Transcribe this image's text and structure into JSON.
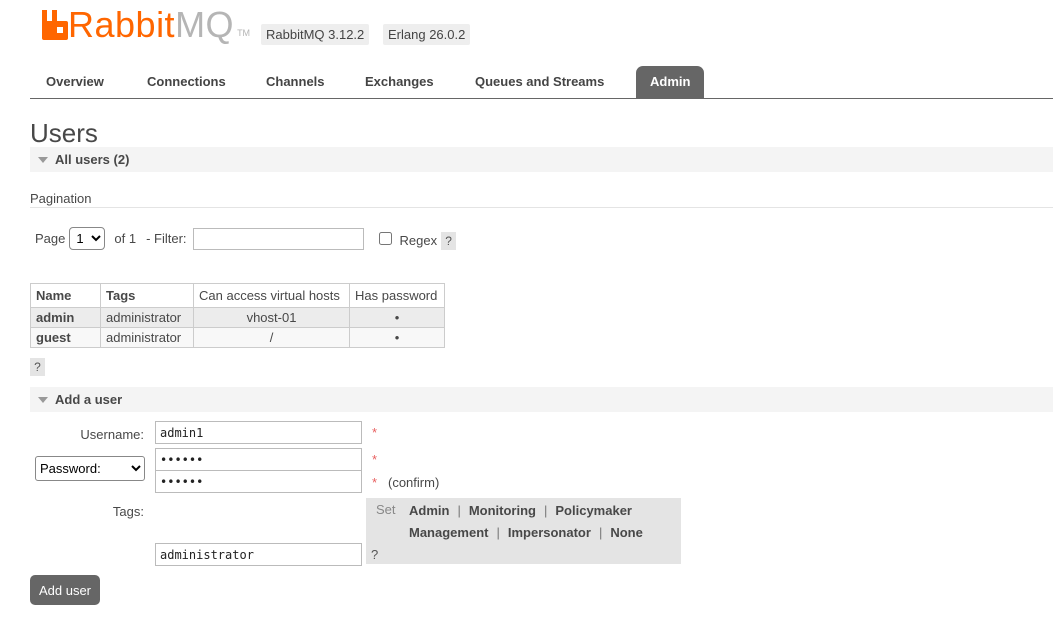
{
  "header": {
    "logo_primary": "Rabbit",
    "logo_secondary": "MQ",
    "logo_tm": "TM",
    "versions": [
      "RabbitMQ 3.12.2",
      "Erlang 26.0.2"
    ]
  },
  "tabs": [
    {
      "label": "Overview",
      "active": false
    },
    {
      "label": "Connections",
      "active": false
    },
    {
      "label": "Channels",
      "active": false
    },
    {
      "label": "Exchanges",
      "active": false
    },
    {
      "label": "Queues and Streams",
      "active": false
    },
    {
      "label": "Admin",
      "active": true
    }
  ],
  "page_title": "Users",
  "all_users": {
    "title": "All users (2)",
    "pagination_label": "Pagination",
    "page_label": "Page",
    "page_value": "1",
    "of_label": "of 1",
    "filter_label": "- Filter:",
    "filter_value": "",
    "regex_label": "Regex",
    "regex_checked": false,
    "help": "?"
  },
  "users_table": {
    "headers": [
      "Name",
      "Tags",
      "Can access virtual hosts",
      "Has password"
    ],
    "rows": [
      {
        "name": "admin",
        "tags": "administrator",
        "vhosts": "vhost-01",
        "has_password": "•"
      },
      {
        "name": "guest",
        "tags": "administrator",
        "vhosts": "/",
        "has_password": "•"
      }
    ],
    "help": "?"
  },
  "add_user": {
    "title": "Add a user",
    "username_label": "Username:",
    "username_value": "admin1",
    "password_mode": "Password:",
    "password_value": "••••••",
    "confirm_value": "••••••",
    "required_mark": "*",
    "confirm_label": "(confirm)",
    "tags_label": "Tags:",
    "tags_value": "administrator",
    "set_label": "Set",
    "tag_options": [
      "Admin",
      "Monitoring",
      "Policymaker",
      "Management",
      "Impersonator",
      "None"
    ],
    "separator": "|",
    "help": "?",
    "submit_label": "Add user"
  },
  "colors": {
    "brand_orange": "#ff6600",
    "tab_active": "#666666",
    "required": "#e85f5f"
  }
}
